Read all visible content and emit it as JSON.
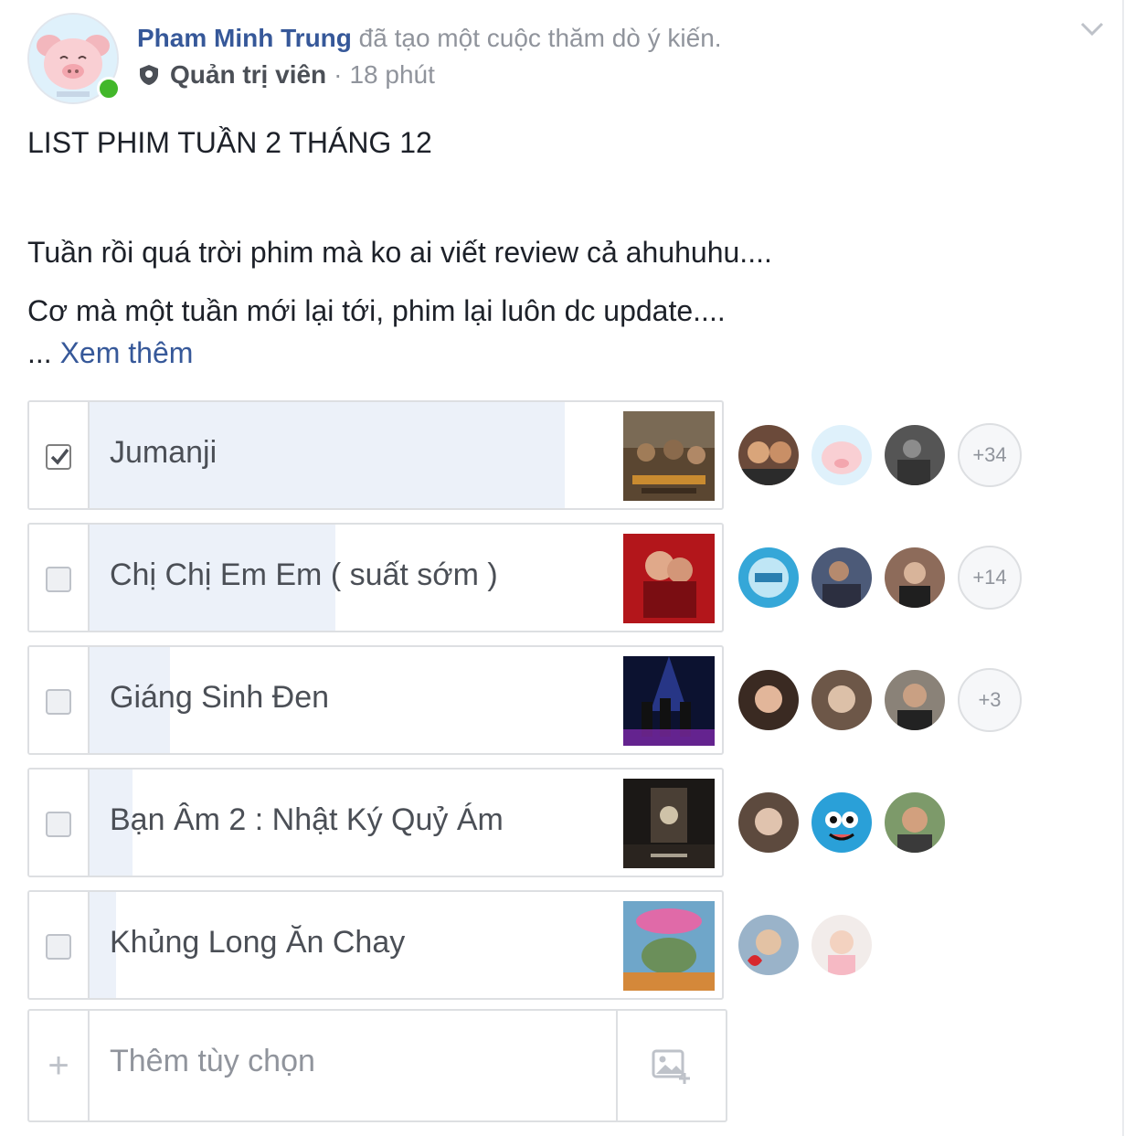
{
  "post": {
    "author": "Pham Minh Trung",
    "action": "đã tạo một cuộc thăm dò ý kiến.",
    "role": "Quản trị viên",
    "separator": "·",
    "time": "18 phút",
    "title": "LIST PHIM TUẦN 2 THÁNG 12",
    "line1": "Tuần rồi quá trời phim mà ko ai viết review cả ahuhuhu....",
    "line2": "Cơ mà một tuần mới lại tới, phim lại luôn dc update....",
    "ellipsis": "...",
    "see_more": "Xem thêm"
  },
  "poll": {
    "options": [
      {
        "label": "Jumanji",
        "checked": true,
        "vote_share": 0.89,
        "extra_voters": "+34",
        "voter_count_shown": 3
      },
      {
        "label": "Chị Chị Em Em ( suất sớm )",
        "checked": false,
        "vote_share": 0.46,
        "extra_voters": "+14",
        "voter_count_shown": 3
      },
      {
        "label": "Giáng Sinh Đen",
        "checked": false,
        "vote_share": 0.15,
        "extra_voters": "+3",
        "voter_count_shown": 3
      },
      {
        "label": "Bạn Âm 2 : Nhật Ký Quỷ Ám",
        "checked": false,
        "vote_share": 0.08,
        "extra_voters": "",
        "voter_count_shown": 3
      },
      {
        "label": "Khủng Long Ăn Chay",
        "checked": false,
        "vote_share": 0.05,
        "extra_voters": "",
        "voter_count_shown": 2
      }
    ],
    "add_option_placeholder": "Thêm tùy chọn",
    "add_option_plus": "+"
  },
  "icons": {
    "header": [
      "shield-icon",
      "chevron-down-icon"
    ],
    "add": [
      "plus-icon",
      "add-photo-icon"
    ]
  },
  "colors": {
    "link": "#365899",
    "meta": "#90949c",
    "poll_fill": "#ecf1f9",
    "online": "#42b72a"
  }
}
